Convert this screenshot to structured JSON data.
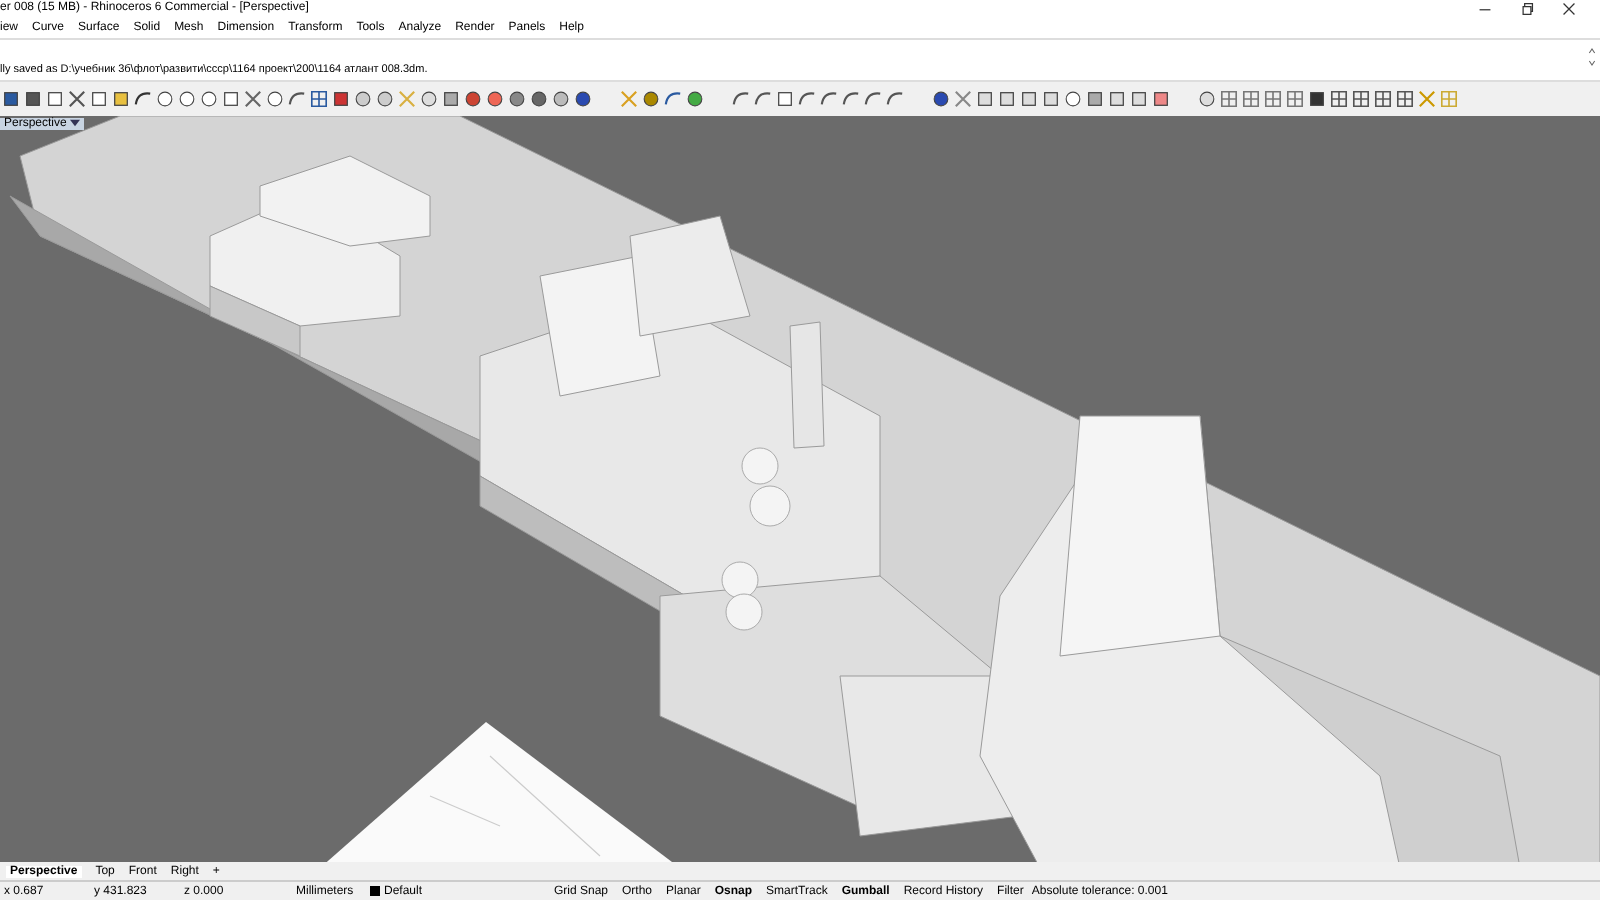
{
  "window": {
    "title": "er 008 (15 MB) - Rhinoceros 6 Commercial - [Perspective]"
  },
  "menu": [
    "iew",
    "Curve",
    "Surface",
    "Solid",
    "Mesh",
    "Dimension",
    "Transform",
    "Tools",
    "Analyze",
    "Render",
    "Panels",
    "Help"
  ],
  "command_history": [
    "lly saved as D:\\учебник 3б\\флот\\развити\\ссср\\1164 проект\\200\\1164 атлант 008.3dm."
  ],
  "viewport": {
    "label": "Perspective"
  },
  "viewport_tabs": [
    {
      "label": "Perspective",
      "selected": true
    },
    {
      "label": "Top",
      "selected": false
    },
    {
      "label": "Front",
      "selected": false
    },
    {
      "label": "Right",
      "selected": false
    }
  ],
  "add_tab": "+",
  "status_bar": {
    "coordinates": [
      "x 0.687",
      "y 431.823",
      "z 0.000"
    ],
    "units": "Millimeters",
    "layer": {
      "name": "Default",
      "color": "#000000"
    },
    "toggles": [
      {
        "label": "Grid Snap",
        "on": false
      },
      {
        "label": "Ortho",
        "on": false
      },
      {
        "label": "Planar",
        "on": false
      },
      {
        "label": "Osnap",
        "on": true
      },
      {
        "label": "SmartTrack",
        "on": false
      },
      {
        "label": "Gumball",
        "on": true
      },
      {
        "label": "Record History",
        "on": false
      },
      {
        "label": "Filter",
        "on": false
      }
    ],
    "tolerance": "Absolute tolerance: 0.001"
  }
}
